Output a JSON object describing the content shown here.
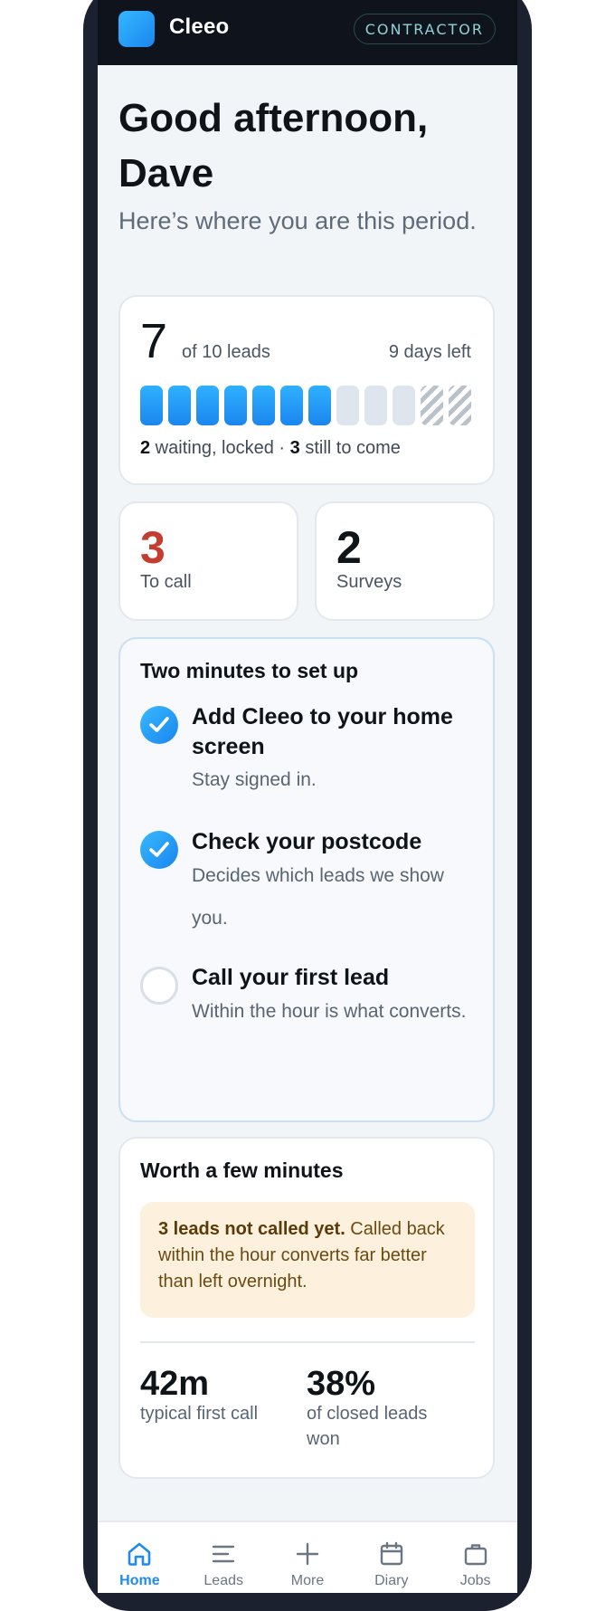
{
  "header": {
    "app_name": "Cleeo",
    "role_badge": "CONTRACTOR"
  },
  "greeting": {
    "title": "Good afternoon, Dave",
    "subtitle": "Here’s where you are this period."
  },
  "progress": {
    "count": "7",
    "of_label": "of 10 leads",
    "days_left": "9 days left",
    "segments": [
      "filled",
      "filled",
      "filled",
      "filled",
      "filled",
      "filled",
      "filled",
      "empty",
      "empty",
      "empty",
      "locked",
      "locked"
    ],
    "waiting_count": "2",
    "waiting_text": " waiting, locked · ",
    "to_come_count": "3",
    "to_come_text": " still to come"
  },
  "stats": {
    "to_call": {
      "value": "3",
      "label": "To call",
      "color": "#c53d31"
    },
    "surveys": {
      "value": "2",
      "label": "Surveys"
    }
  },
  "setup": {
    "title": "Two minutes to set up",
    "steps": [
      {
        "title": "Add Cleeo to your home screen",
        "desc": "Stay signed in.",
        "done": true
      },
      {
        "title": "Check your postcode",
        "desc": "Decides which leads we show you.",
        "done": true
      },
      {
        "title": "Call your first lead",
        "desc": "Within the hour is what converts.",
        "done": false
      }
    ]
  },
  "worth": {
    "title": "Worth a few minutes",
    "alert_bold": "3 leads not called yet.",
    "alert_text": " Called back within the hour converts far better than left overnight.",
    "metrics": [
      {
        "value": "42m",
        "label": "typical first call"
      },
      {
        "value": "38%",
        "label": "of closed leads won"
      }
    ]
  },
  "nav": {
    "items": [
      {
        "label": "Home",
        "icon": "home-icon",
        "active": true
      },
      {
        "label": "Leads",
        "icon": "list-icon",
        "active": false
      },
      {
        "label": "More",
        "icon": "plus-icon",
        "active": false
      },
      {
        "label": "Diary",
        "icon": "calendar-icon",
        "active": false
      },
      {
        "label": "Jobs",
        "icon": "briefcase-icon",
        "active": false
      }
    ]
  },
  "colors": {
    "accent": "#1f8bf0",
    "danger": "#c53d31",
    "alert_bg": "#fdf1dd"
  }
}
